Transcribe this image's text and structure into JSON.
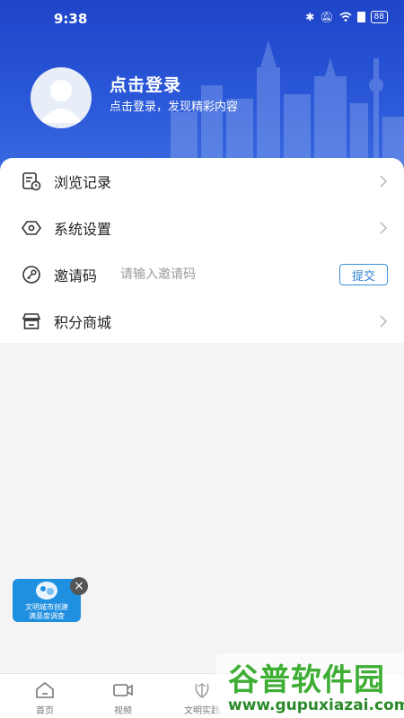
{
  "status_bar": {
    "time": "9:38",
    "battery": "88"
  },
  "profile": {
    "login_title": "点击登录",
    "login_subtitle": "点击登录，发现精彩内容"
  },
  "menu": {
    "history": {
      "label": "浏览记录",
      "icon": "history-icon"
    },
    "settings": {
      "label": "系统设置",
      "icon": "settings-icon"
    },
    "invite": {
      "label": "邀请码",
      "placeholder": "请输入邀请码",
      "submit_label": "提交",
      "icon": "key-icon"
    },
    "points_mall": {
      "label": "积分商城",
      "icon": "store-icon"
    }
  },
  "float_ad": {
    "line1": "文明城市创建",
    "line2": "满意度调查"
  },
  "tabs": [
    {
      "label": "首页",
      "icon": "home-icon"
    },
    {
      "label": "视频",
      "icon": "video-icon"
    },
    {
      "label": "文明实践",
      "icon": "emblem-icon"
    }
  ],
  "watermark": {
    "title": "谷普软件园",
    "url": "www.gupuxiazai.com"
  },
  "colors": {
    "header_blue": "#2650d4",
    "accent_blue": "#2f82d2",
    "watermark_green": "#3fae34"
  }
}
